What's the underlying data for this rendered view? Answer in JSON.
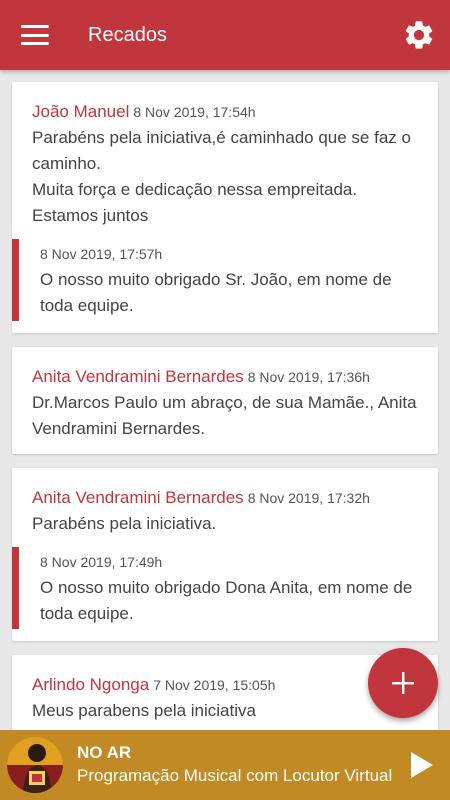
{
  "appbar": {
    "title": "Recados",
    "menu_icon": "hamburger-menu-icon",
    "settings_icon": "gear-icon",
    "color": "#c1353d"
  },
  "messages": [
    {
      "author": "João Manuel",
      "date": "8 Nov 2019, 17:54h",
      "text": "Parabéns pela iniciativa,é caminhado que se faz o caminho.\nMuita força e dedicação nessa empreitada. Estamos juntos",
      "reply": {
        "date": "8 Nov 2019, 17:57h",
        "text": "O nosso muito obrigado Sr. João, em nome de toda equipe."
      }
    },
    {
      "author": "Anita Vendramini Bernardes",
      "date": "8 Nov 2019, 17:36h",
      "text": "Dr.Marcos Paulo um abraço, de sua Mamãe., Anita Vendramini Bernardes."
    },
    {
      "author": "Anita Vendramini Bernardes",
      "date": "8 Nov 2019, 17:32h",
      "text": "Parabéns  pela  iniciativa.",
      "reply": {
        "date": "8 Nov 2019, 17:49h",
        "text": "O nosso muito obrigado Dona Anita, em nome de toda equipe."
      }
    },
    {
      "author": "Arlindo Ngonga",
      "date": "7 Nov 2019, 15:05h",
      "text": "Meus parabens pela iniciativa"
    }
  ],
  "fab": {
    "icon": "plus-icon"
  },
  "player": {
    "status": "NO AR",
    "program": "Programação Musical com Locutor Virtual",
    "cover_icon": "program-cover-image",
    "play_icon": "play-icon",
    "color": "#c28a25"
  }
}
